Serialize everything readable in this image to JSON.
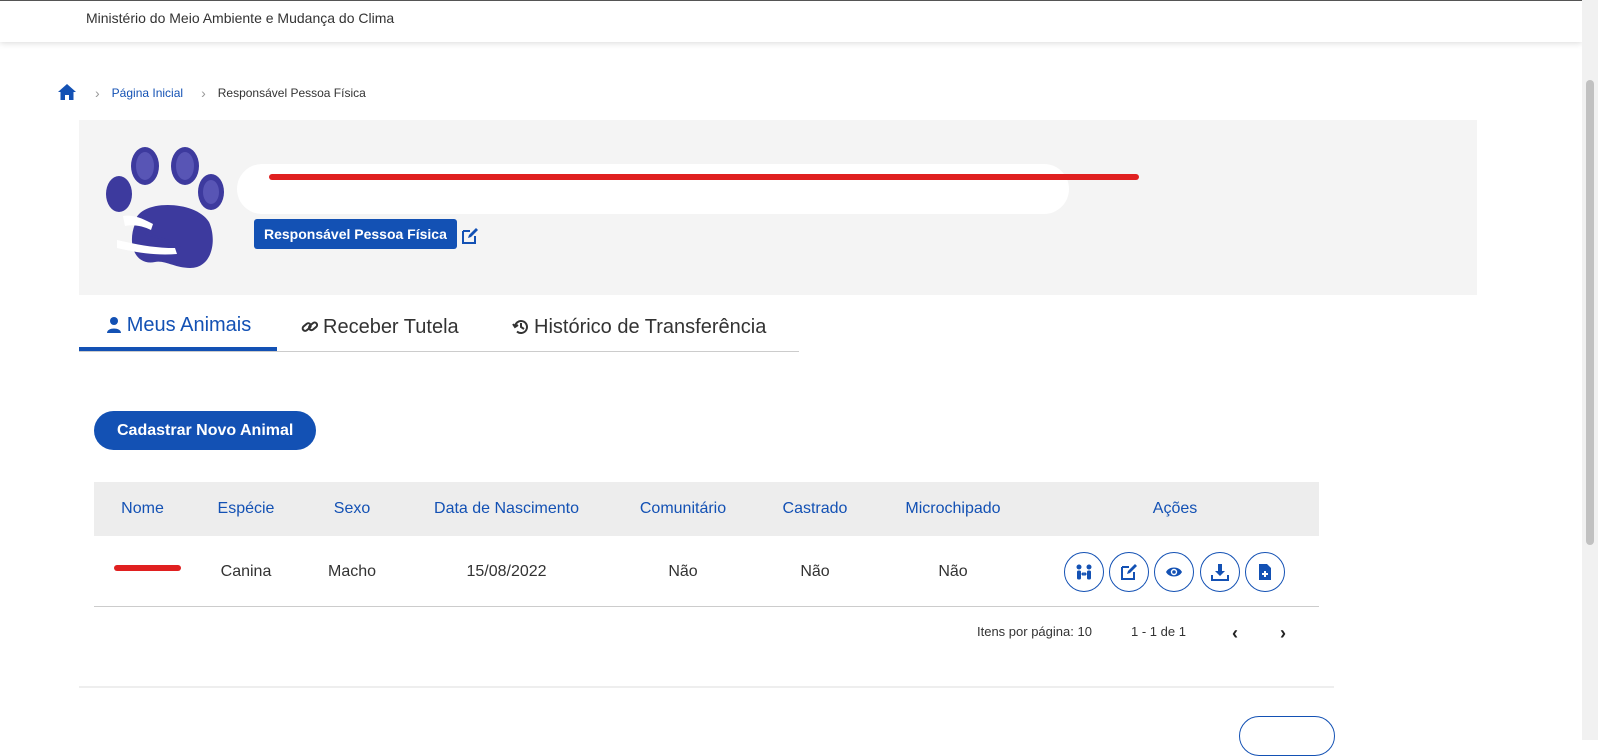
{
  "header": {
    "ministry": "Ministério do Meio Ambiente e Mudança do Clima"
  },
  "breadcrumb": {
    "home_icon": "home-icon",
    "items": [
      "Página Inicial",
      "Responsável Pessoa Física"
    ]
  },
  "profile": {
    "role": "Responsável Pessoa Física",
    "edit_icon": "edit-icon",
    "avatar": "paw-hug-logo"
  },
  "tabs": [
    {
      "label": "Meus Animais",
      "icon": "person-icon",
      "active": true
    },
    {
      "label": "Receber Tutela",
      "icon": "link-icon",
      "active": false
    },
    {
      "label": "Histórico de Transferência",
      "icon": "history-icon",
      "active": false
    }
  ],
  "actions": {
    "add_animal": "Cadastrar Novo Animal"
  },
  "table": {
    "headers": [
      "Nome",
      "Espécie",
      "Sexo",
      "Data de Nascimento",
      "Comunitário",
      "Castrado",
      "Microchipado",
      "Ações"
    ],
    "rows": [
      {
        "nome": "",
        "especie": "Canina",
        "sexo": "Macho",
        "nascimento": "15/08/2022",
        "comunitario": "Não",
        "castrado": "Não",
        "microchipado": "Não"
      }
    ],
    "row_actions": [
      "transfer-icon",
      "edit-icon",
      "view-icon",
      "download-icon",
      "document-add-icon"
    ]
  },
  "pagination": {
    "items_per_page": "Itens por página: 10",
    "range": "1 - 1 de 1"
  },
  "colors": {
    "primary": "#1351b4",
    "redaction": "#e02020",
    "panel": "#f4f4f4"
  }
}
